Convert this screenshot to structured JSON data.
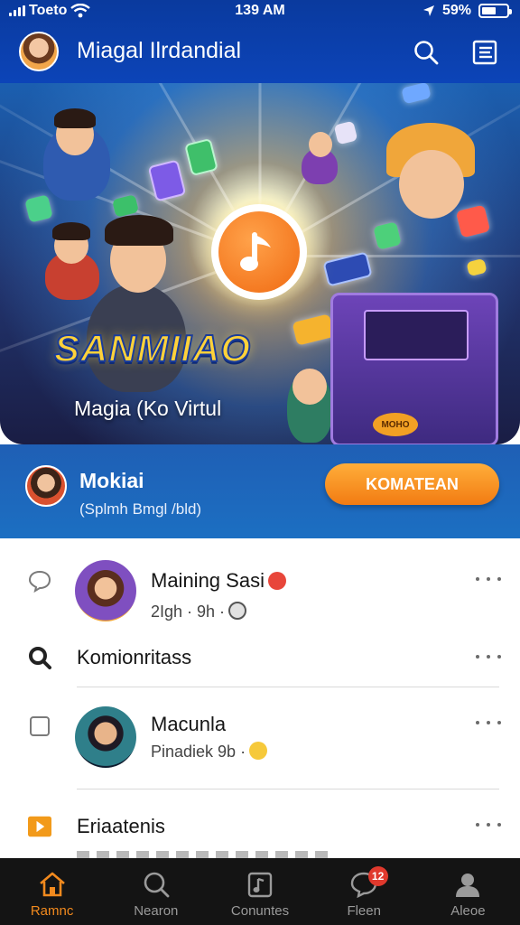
{
  "status_bar": {
    "carrier": "Toeto",
    "time": "139 AM",
    "battery": "59%",
    "battery_level": 0.59
  },
  "header": {
    "title": "Miagal Ilrdandial",
    "search_icon": "search-icon",
    "menu_icon": "list-menu-icon"
  },
  "hero": {
    "title": "SANMIIAO",
    "subtitle": "Magia (Ko Virtul",
    "console_label": "MOHO",
    "center_icon": "music-note-icon"
  },
  "profile": {
    "name": "Mokiai",
    "subtitle": "(Splmh Bmgl /bld)",
    "cta_label": "KOMATEAN"
  },
  "list": [
    {
      "type": "person",
      "icon": "comment-icon",
      "title": "Maining Sasi",
      "subtitle": "2Igh · 9h ·"
    },
    {
      "type": "section",
      "icon": "search-icon",
      "title": "Komionritass"
    },
    {
      "type": "person",
      "icon": "checkbox-icon",
      "title": "Macunla",
      "subtitle": "Pinadiek 9b ·"
    },
    {
      "type": "section",
      "icon": "play-icon",
      "title": "Eriaatenis"
    }
  ],
  "nav": [
    {
      "label": "Ramnc",
      "icon": "home-icon",
      "active": true
    },
    {
      "label": "Nearon",
      "icon": "search-icon",
      "active": false
    },
    {
      "label": "Conuntes",
      "icon": "music-library-icon",
      "active": false
    },
    {
      "label": "Fleen",
      "icon": "chat-icon",
      "active": false,
      "badge": "12"
    },
    {
      "label": "Aleoe",
      "icon": "profile-icon",
      "active": false
    }
  ],
  "colors": {
    "header_blue": "#0c44b8",
    "accent_orange": "#f27b12",
    "nav_bg": "#141414",
    "badge_red": "#e0392d"
  }
}
